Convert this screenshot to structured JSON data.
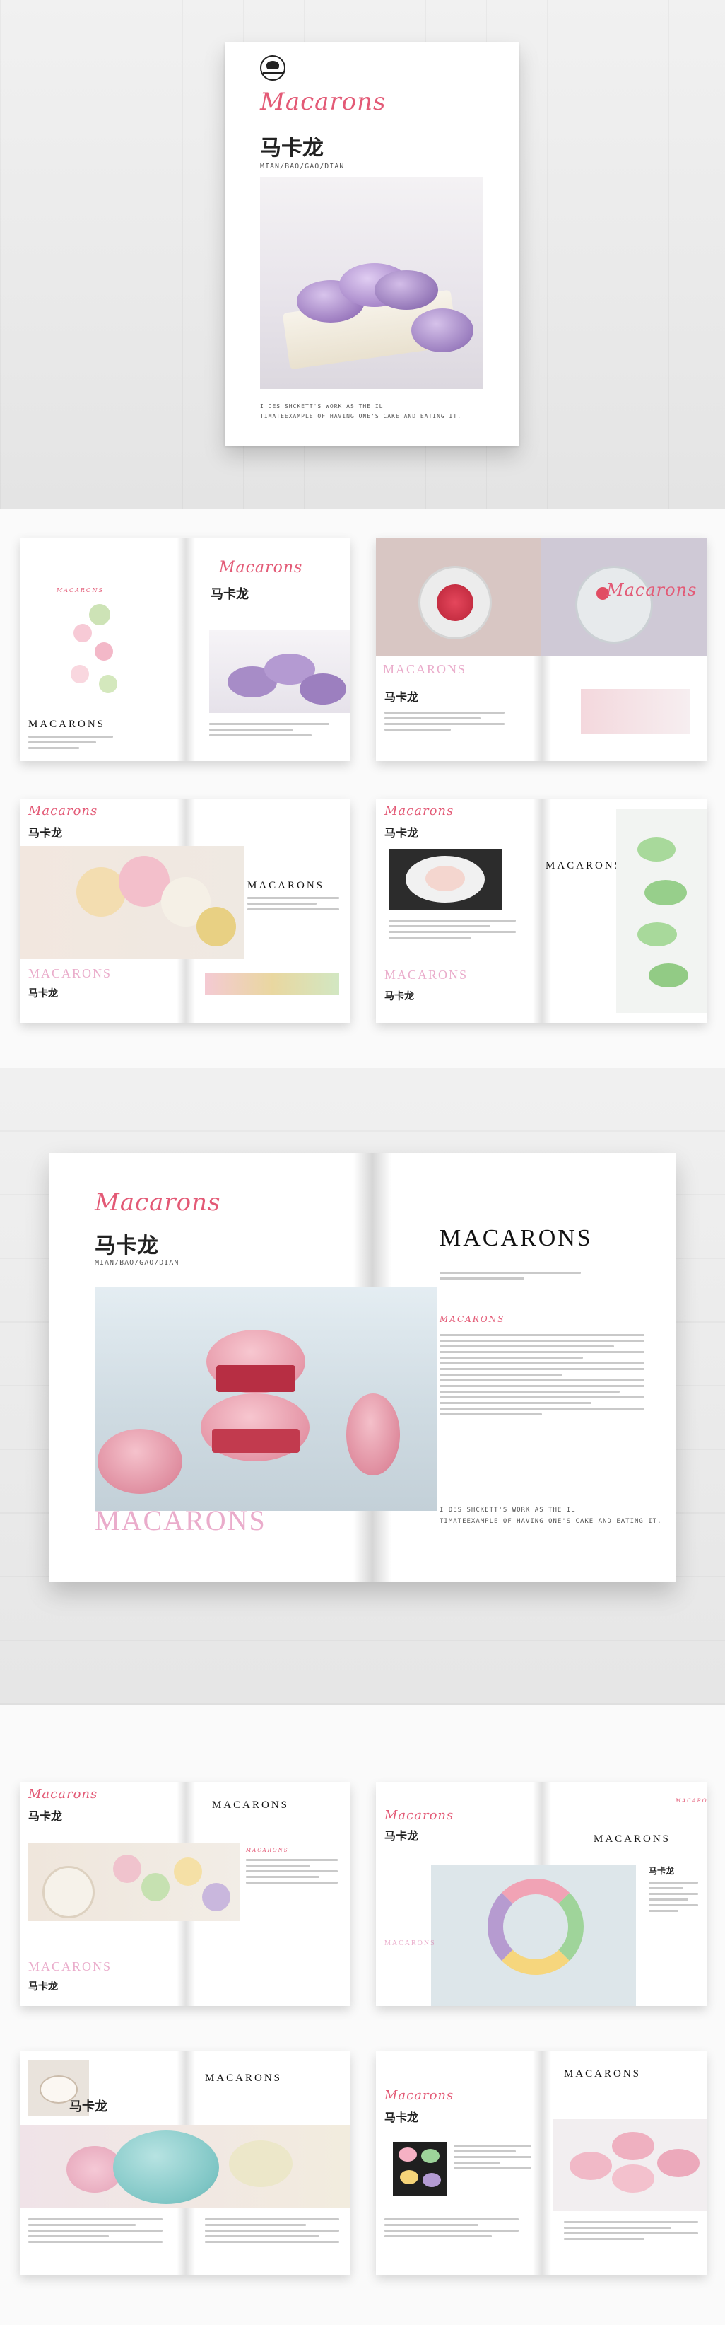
{
  "cover": {
    "script_title": "Macarons",
    "cn_title": "马卡龙",
    "pinyin": "MIAN/BAO/GAO/DIAN",
    "tagline_1": "I DES SHCKETT'S WORK AS THE IL",
    "tagline_2": "TIMATEEXAMPLE OF HAVING ONE'S CAKE AND EATING IT."
  },
  "spreads": {
    "heading": "MACARONS",
    "script_title": "Macarons",
    "cn_title": "马卡龙",
    "outline": "MACARONS",
    "sub_heading": "MACARONS"
  },
  "feature": {
    "script_title": "Macarons",
    "cn_title": "马卡龙",
    "pinyin": "MIAN/BAO/GAO/DIAN",
    "heading": "MACARONS",
    "sub_heading": "MACARONS",
    "outline": "MACARONS",
    "footer_1": "I DES SHCKETT'S WORK AS THE IL",
    "footer_2": "TIMATEEXAMPLE OF HAVING ONE'S CAKE AND EATING IT."
  },
  "colors": {
    "accent_pink": "#e35a76",
    "outline_pink": "#d968a0",
    "lavender": "#b69bd0",
    "mint": "#9fd49a"
  }
}
